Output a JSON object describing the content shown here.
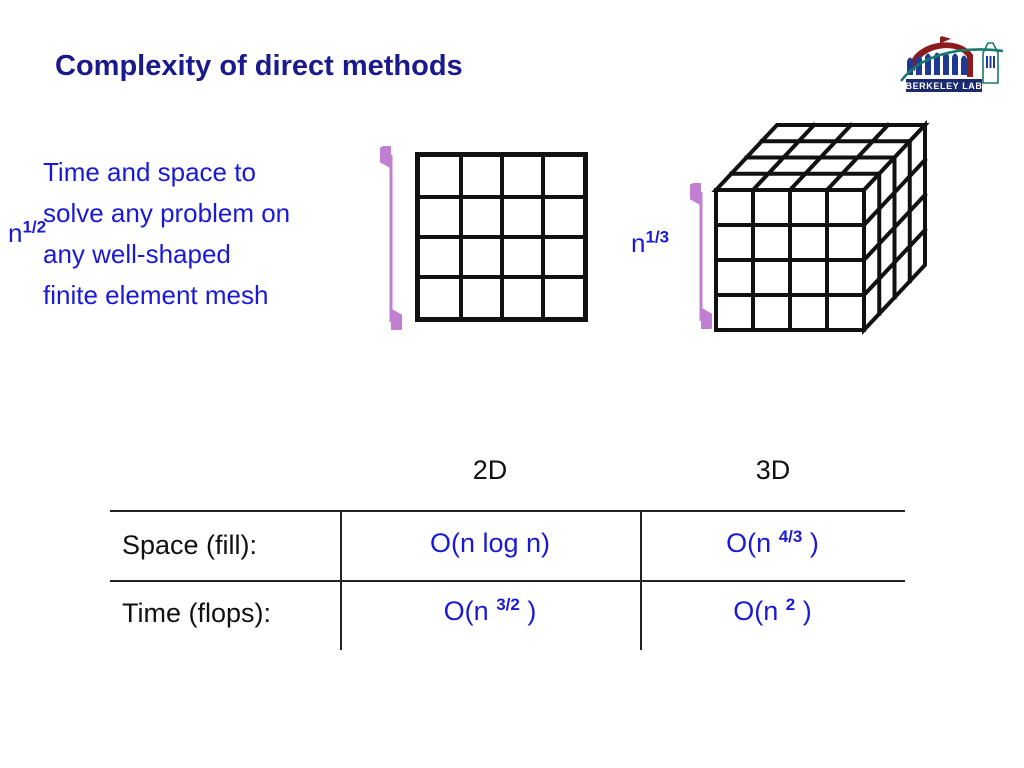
{
  "slide": {
    "title": "Complexity of direct methods"
  },
  "logo": {
    "name": "berkeley-lab-logo",
    "banner_text": "BERKELEY LAB",
    "dome_color": "#8c1b1b",
    "arch_color": "#1f3a93",
    "swoosh_color": "#1a7a6e",
    "banner_color": "#1a2a6c"
  },
  "intro": {
    "text": "Time and space to solve any problem on any well-shaped finite element mesh",
    "color": "#1a1ad6"
  },
  "figures": {
    "grid_2d": {
      "name": "2d-mesh-grid",
      "rows": 4,
      "cols": 4,
      "label_base": "n",
      "label_exponent": "1/2",
      "line_color": "#111111",
      "arrow_color": "#c07fd0"
    },
    "cube_3d": {
      "name": "3d-mesh-cube",
      "rows": 4,
      "cols": 4,
      "depth": 4,
      "label_base": "n",
      "label_exponent": "1/3",
      "line_color": "#111111",
      "arrow_color": "#c07fd0"
    }
  },
  "table": {
    "columns": [
      "2D",
      "3D"
    ],
    "rows": [
      {
        "label": "Space (fill):",
        "cells": [
          {
            "text": "O(n log n)",
            "base": "O(n log n)",
            "exponent": ""
          },
          {
            "text": "O(n 4/3 )",
            "prefix": "O(n ",
            "exponent": "4/3",
            "suffix": " )"
          }
        ]
      },
      {
        "label": "Time (flops):",
        "cells": [
          {
            "text": "O(n 3/2 )",
            "prefix": "O(n ",
            "exponent": "3/2",
            "suffix": " )"
          },
          {
            "text": "O(n 2 )",
            "prefix": "O(n ",
            "exponent": "2",
            "suffix": " )"
          }
        ]
      }
    ],
    "value_color": "#1a1ad6",
    "label_color": "#111111"
  }
}
